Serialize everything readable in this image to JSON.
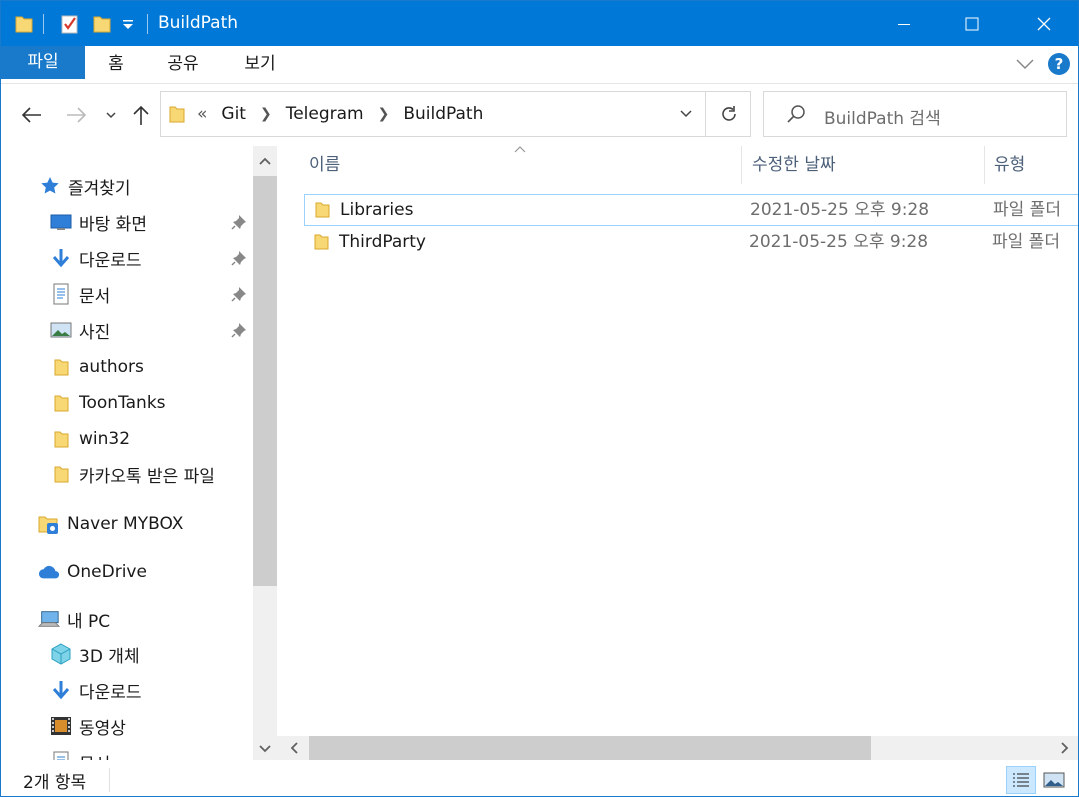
{
  "window": {
    "title": "BuildPath"
  },
  "ribbon": {
    "tabs": [
      "파일",
      "홈",
      "공유",
      "보기"
    ]
  },
  "address": {
    "crumbs": [
      "Git",
      "Telegram",
      "BuildPath"
    ],
    "overflow": "«"
  },
  "search": {
    "placeholder": "BuildPath 검색"
  },
  "nav": {
    "quick_access": "즐겨찾기",
    "pinned": [
      "바탕 화면",
      "다운로드",
      "문서",
      "사진"
    ],
    "folders": [
      "authors",
      "ToonTanks",
      "win32",
      "카카오톡 받은 파일"
    ],
    "mybox": "Naver MYBOX",
    "onedrive": "OneDrive",
    "thispc": "내 PC",
    "pc_items": [
      "3D 개체",
      "다운로드",
      "동영상",
      "문서"
    ]
  },
  "columns": {
    "name": "이름",
    "date": "수정한 날짜",
    "type": "유형"
  },
  "files": [
    {
      "name": "Libraries",
      "date": "2021-05-25 오후 9:28",
      "type": "파일 폴더"
    },
    {
      "name": "ThirdParty",
      "date": "2021-05-25 오후 9:28",
      "type": "파일 폴더"
    }
  ],
  "status": {
    "count": "2개 항목"
  },
  "colors": {
    "accent": "#0078d7",
    "file_tab": "#1979ca",
    "folder": "#f8d775"
  }
}
